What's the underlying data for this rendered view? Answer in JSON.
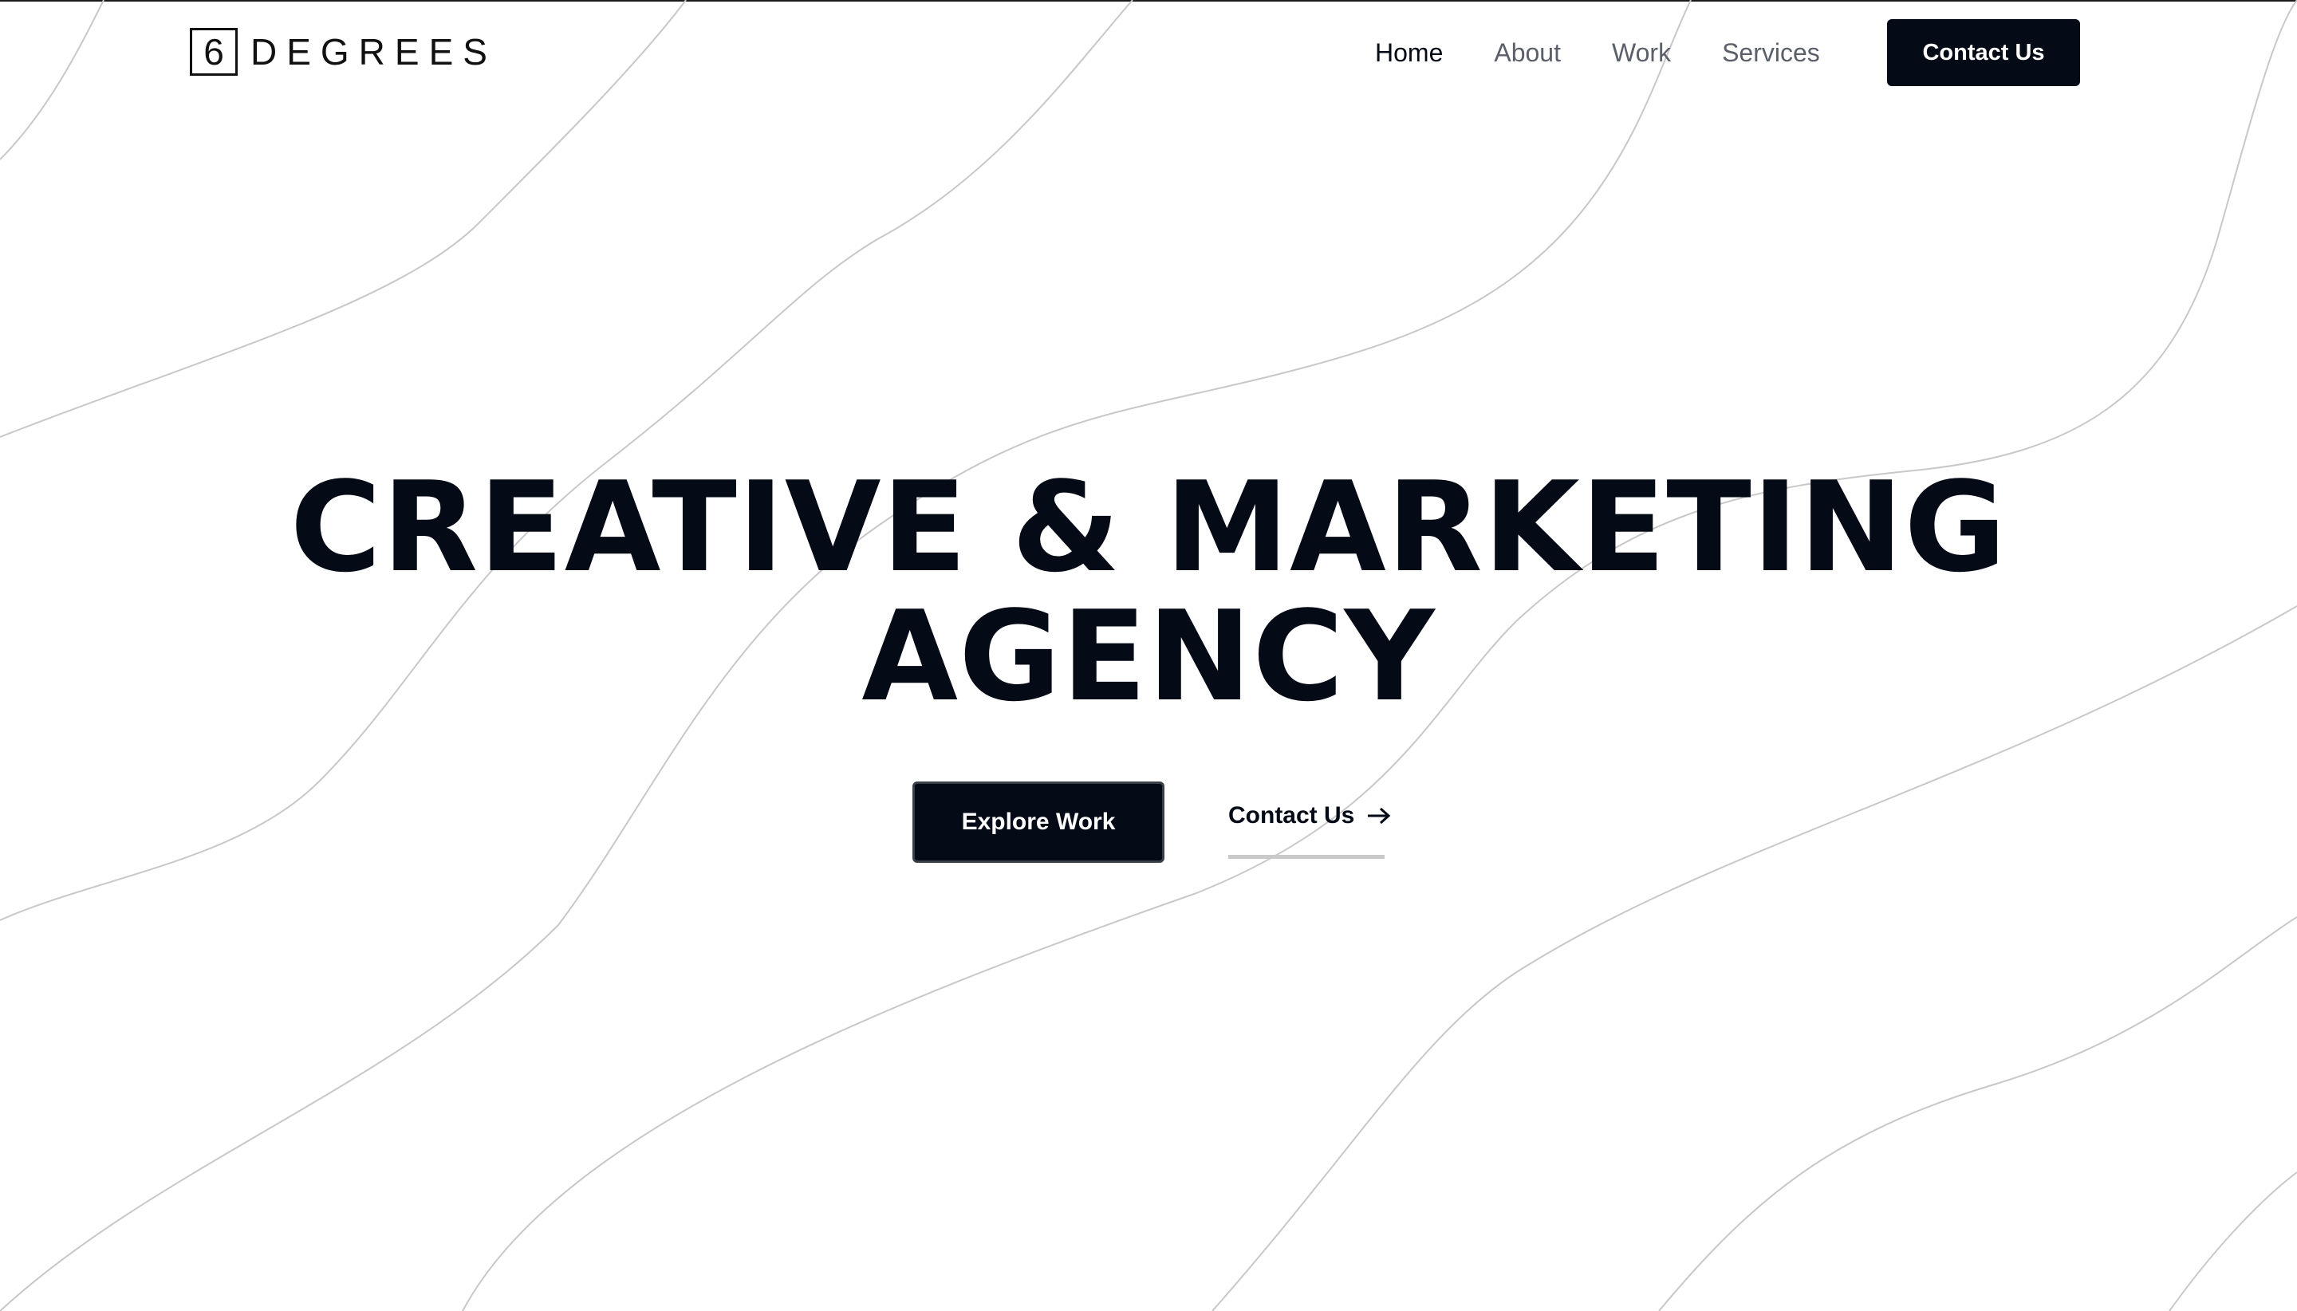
{
  "brand": {
    "logo_mark": "6",
    "logo_text": "DEGREES"
  },
  "nav": {
    "items": [
      {
        "label": "Home",
        "active": true
      },
      {
        "label": "About",
        "active": false
      },
      {
        "label": "Work",
        "active": false
      },
      {
        "label": "Services",
        "active": false
      }
    ],
    "cta_label": "Contact Us"
  },
  "hero": {
    "title_line1": "CREATIVE & MARKETING",
    "title_line2": "AGENCY",
    "primary_button": "Explore Work",
    "secondary_link": "Contact Us",
    "secondary_icon": "arrow-right-icon"
  },
  "colors": {
    "primary": "#050a17",
    "background": "#ffffff",
    "nav_inactive": "#5a5f6a",
    "decor_lines": "#c8c8c8"
  }
}
